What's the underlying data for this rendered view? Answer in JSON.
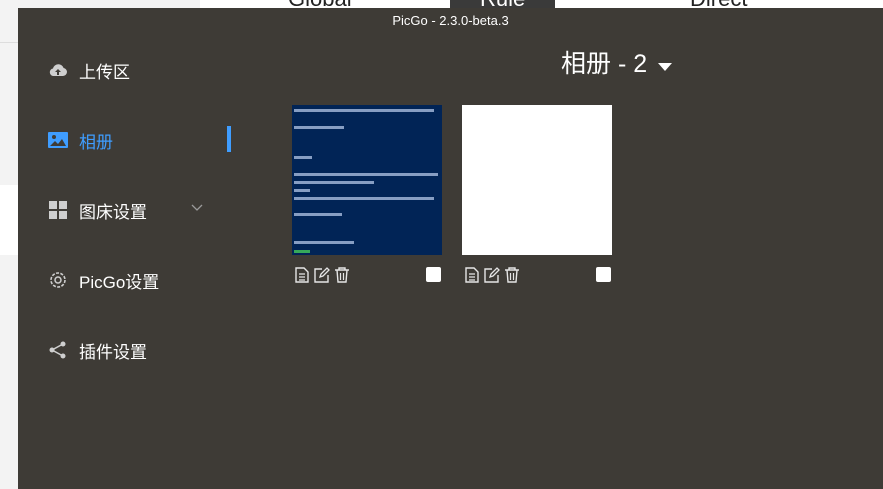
{
  "background": {
    "tabs": [
      "Global",
      "Rule",
      "Direct"
    ]
  },
  "window": {
    "title": "PicGo - 2.3.0-beta.3"
  },
  "sidebar": {
    "items": [
      {
        "label": "上传区",
        "icon": "cloud-upload-icon",
        "active": false
      },
      {
        "label": "相册",
        "icon": "image-icon",
        "active": true
      },
      {
        "label": "图床设置",
        "icon": "grid-icon",
        "active": false,
        "expandable": true
      },
      {
        "label": "PicGo设置",
        "icon": "gear-icon",
        "active": false
      },
      {
        "label": "插件设置",
        "icon": "share-icon",
        "active": false
      }
    ]
  },
  "album": {
    "title": "相册 - 2",
    "images": [
      {
        "kind": "powershell-screenshot",
        "selected": false
      },
      {
        "kind": "blank-white",
        "selected": false
      }
    ],
    "item_actions": [
      "copy-link-icon",
      "edit-icon",
      "delete-icon"
    ]
  },
  "colors": {
    "window_bg": "#3e3b36",
    "accent": "#3f9dff",
    "text": "#ffffff",
    "terminal_bg": "#012456"
  }
}
